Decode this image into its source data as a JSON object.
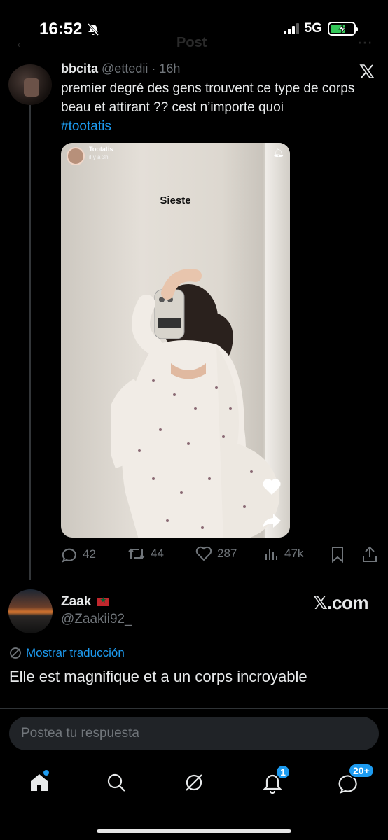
{
  "status_bar": {
    "time": "16:52",
    "network": "5G",
    "icons": [
      "mute-icon",
      "signal-icon",
      "battery-charging-icon"
    ]
  },
  "header": {
    "title": "Post",
    "icons": [
      "back-arrow-icon",
      "more-icon"
    ]
  },
  "quoted_tweet": {
    "name": "bbcita",
    "handle": "@ettedii",
    "time_suffix": "· 16h",
    "text": "premier degré des gens trouvent ce type de corps beau et attirant ?? cest n’importe quoi",
    "hashtag": "#tootatis",
    "media": {
      "account": "Tootatis",
      "posted_ago": "il y a 3h",
      "caption": "Sieste"
    },
    "actions": {
      "replies": "42",
      "reposts": "44",
      "likes": "287",
      "views": "47k"
    }
  },
  "reply": {
    "name": "Zaak",
    "handle": "@Zaakii92_",
    "watermark": "𝕏.com",
    "translate_label": "Mostrar traducción",
    "text": "Elle est magnifique et a un corps incroyable"
  },
  "composer": {
    "placeholder": "Postea tu respuesta"
  },
  "tab_bar": {
    "items": [
      "home-icon",
      "search-icon",
      "grok-icon",
      "notifications-icon",
      "messages-icon"
    ],
    "notifications_badge": "1",
    "messages_badge": "20+"
  },
  "colors": {
    "accent": "#1d9bf0",
    "text": "#e7e9ea",
    "muted": "#71767b",
    "background": "#000000"
  }
}
